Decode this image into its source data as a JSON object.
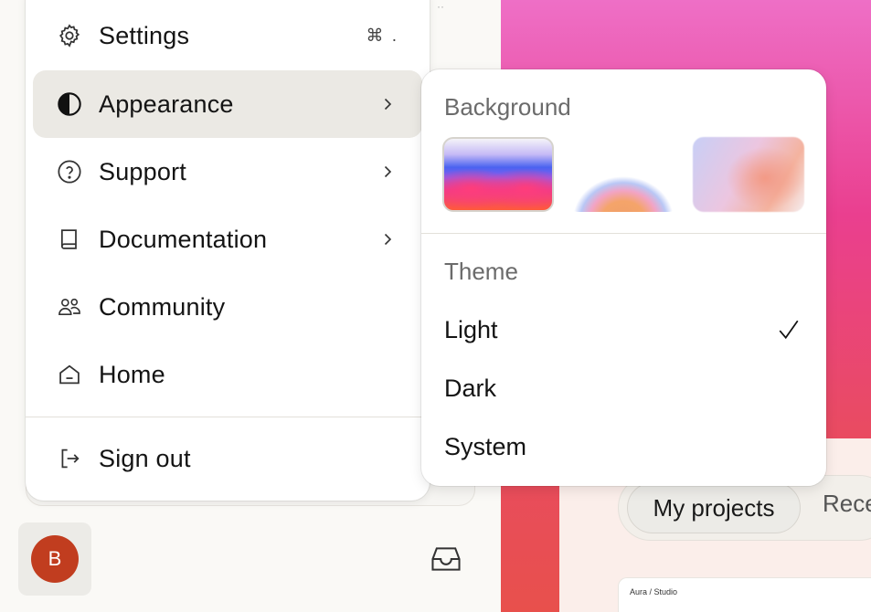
{
  "menu": {
    "items": [
      {
        "label": "Settings",
        "icon": "gear-icon",
        "shortcut": "⌘ .",
        "has_submenu": false
      },
      {
        "label": "Appearance",
        "icon": "contrast-icon",
        "has_submenu": true,
        "active": true
      },
      {
        "label": "Support",
        "icon": "help-circle-icon",
        "has_submenu": true
      },
      {
        "label": "Documentation",
        "icon": "book-icon",
        "has_submenu": true
      },
      {
        "label": "Community",
        "icon": "people-icon",
        "has_submenu": false
      },
      {
        "label": "Home",
        "icon": "home-icon",
        "has_submenu": false
      }
    ],
    "sign_out": {
      "label": "Sign out",
      "icon": "sign-out-icon"
    }
  },
  "appearance_submenu": {
    "background_heading": "Background",
    "backgrounds": [
      "wave-gradient",
      "sunrise-gradient",
      "blur-gradient"
    ],
    "selected_background": 0,
    "theme_heading": "Theme",
    "themes": [
      "Light",
      "Dark",
      "System"
    ],
    "selected_theme": "Light"
  },
  "main": {
    "tabs": [
      "My projects",
      "Rece"
    ],
    "active_tab": "My projects",
    "project_card_title": "Aura / Studio"
  },
  "user": {
    "avatar_initial": "B",
    "avatar_color": "#c13d1f"
  },
  "colors": {
    "accent_pink": "#ea3f8f",
    "menu_active_bg": "#ebe9e4"
  }
}
